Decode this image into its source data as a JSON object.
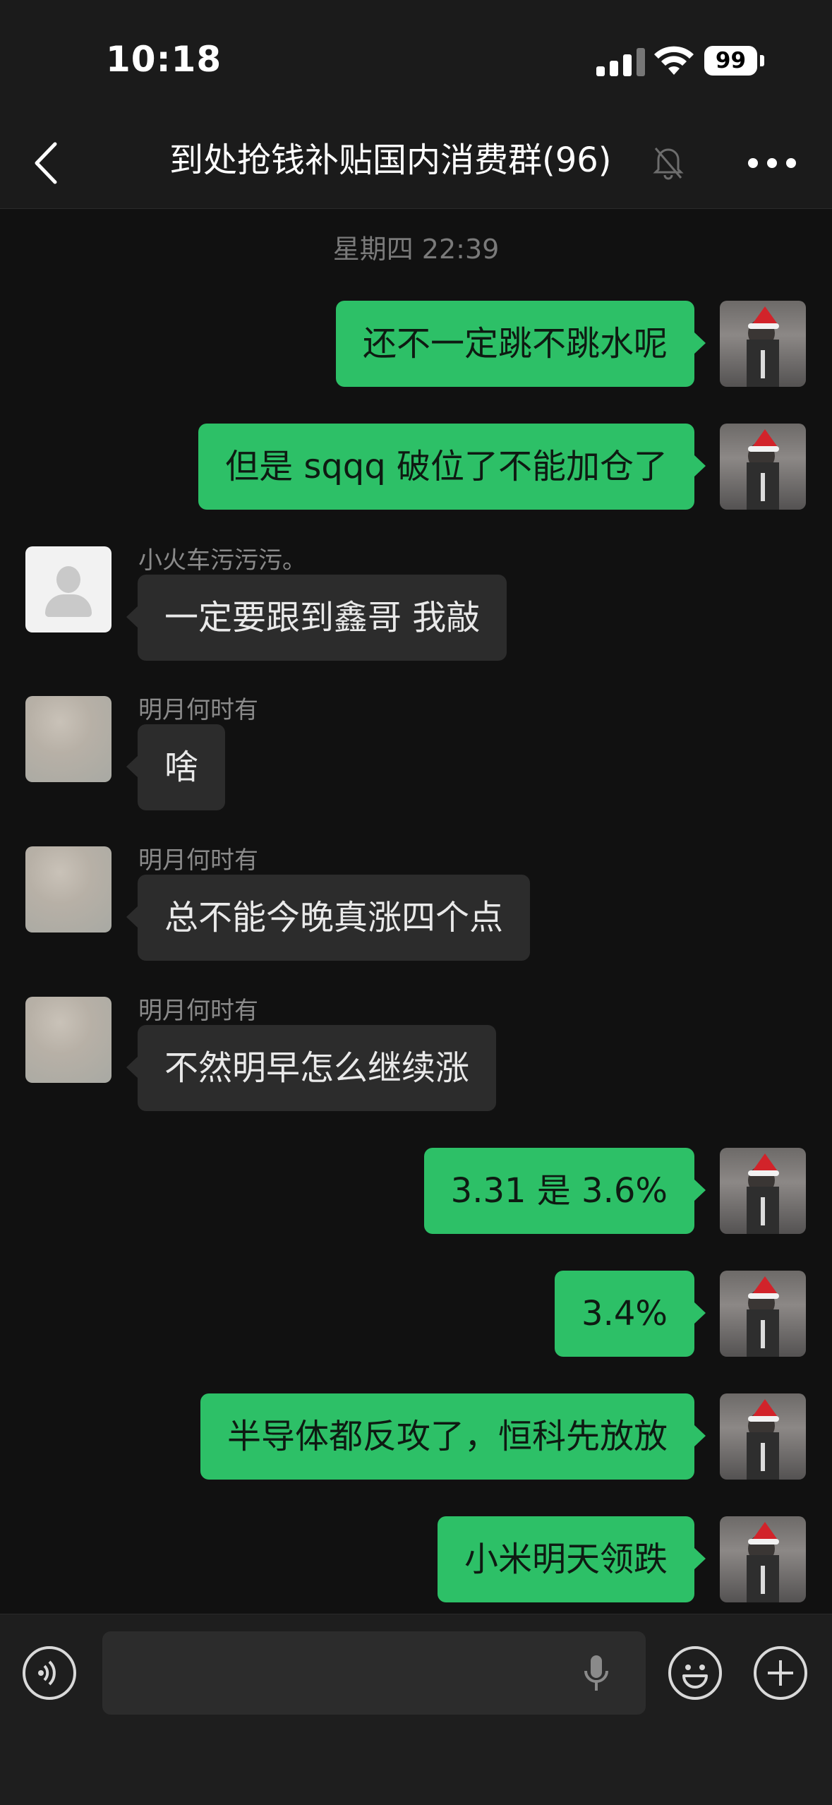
{
  "status_bar": {
    "time": "10:18",
    "battery": "99"
  },
  "nav": {
    "title": "到处抢钱补贴国内消费群(96)"
  },
  "chat": {
    "timestamp": "星期四 22:39",
    "messages": [
      {
        "from": "me",
        "text": "还不一定跳不跳水呢"
      },
      {
        "from": "me",
        "text": "但是 sqqq 破位了不能加仓了"
      },
      {
        "from": "other",
        "sender": "小火车污污污。",
        "text": "一定要跟到鑫哥 我敲"
      },
      {
        "from": "other",
        "sender": "明月何时有",
        "text": "啥"
      },
      {
        "from": "other",
        "sender": "明月何时有",
        "text": "总不能今晚真涨四个点"
      },
      {
        "from": "other",
        "sender": "明月何时有",
        "text": "不然明早怎么继续涨"
      },
      {
        "from": "me",
        "text": "3.31 是 3.6%"
      },
      {
        "from": "me",
        "text": "3.4%"
      },
      {
        "from": "me",
        "text": "半导体都反攻了，恒科先放放"
      },
      {
        "from": "me",
        "text": "小米明天领跌"
      }
    ]
  },
  "input_bar": {
    "icons": [
      "voice-mode-icon",
      "microphone-icon",
      "emoji-icon",
      "plus-icon"
    ]
  },
  "colors": {
    "my_bubble": "#2dc067",
    "other_bubble": "#2c2c2c",
    "background": "#111111"
  }
}
